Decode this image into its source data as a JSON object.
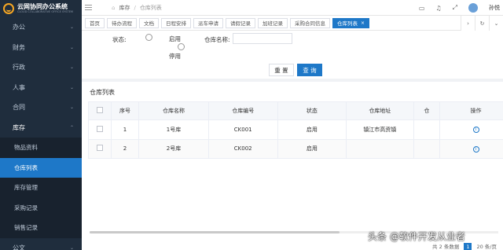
{
  "app": {
    "title": "云网协同办公系统",
    "subtitle": "CLOUD COLLABORATIVE OFFICE SYSTEM"
  },
  "sidebar": {
    "items": [
      {
        "label": "办公"
      },
      {
        "label": "财务"
      },
      {
        "label": "行政"
      },
      {
        "label": "人事"
      },
      {
        "label": "合同"
      },
      {
        "label": "库存"
      }
    ],
    "submenu": [
      {
        "label": "物品资料"
      },
      {
        "label": "仓库列表"
      },
      {
        "label": "库存管理"
      },
      {
        "label": "采购记录"
      },
      {
        "label": "销售记录"
      }
    ],
    "bottom": {
      "label": "公文"
    }
  },
  "topbar": {
    "crumb_parent": "库存",
    "crumb_current": "仓库列表",
    "user": "孙悦"
  },
  "tabs": [
    {
      "label": "首页"
    },
    {
      "label": "待办流程"
    },
    {
      "label": "文档"
    },
    {
      "label": "日程安排"
    },
    {
      "label": "派车申请"
    },
    {
      "label": "请假记录"
    },
    {
      "label": "加班记录"
    },
    {
      "label": "采购合同信息"
    },
    {
      "label": "仓库列表"
    }
  ],
  "search": {
    "status_label": "状态:",
    "enabled_label": "启用",
    "disabled_label": "停用",
    "name_label": "仓库名称:",
    "name_value": "",
    "reset_label": "重 置",
    "query_label": "查 询"
  },
  "list": {
    "title": "仓库列表",
    "columns": [
      "",
      "序号",
      "仓库名称",
      "仓库编号",
      "状态",
      "仓库地址",
      "仓",
      "操作"
    ],
    "rows": [
      {
        "no": "1",
        "name": "1号库",
        "code": "CK001",
        "status": "启用",
        "address": "镇江市高资镇"
      },
      {
        "no": "2",
        "name": "2号库",
        "code": "CK002",
        "status": "启用",
        "address": ""
      }
    ]
  },
  "pager": {
    "total": "共 2 条数据",
    "page": "1",
    "size": "20 条/页"
  },
  "watermark": "头条 @软件开发从业者",
  "colors": {
    "sidebar_bg": "#1f2d3d",
    "accent": "#1e78c8"
  }
}
